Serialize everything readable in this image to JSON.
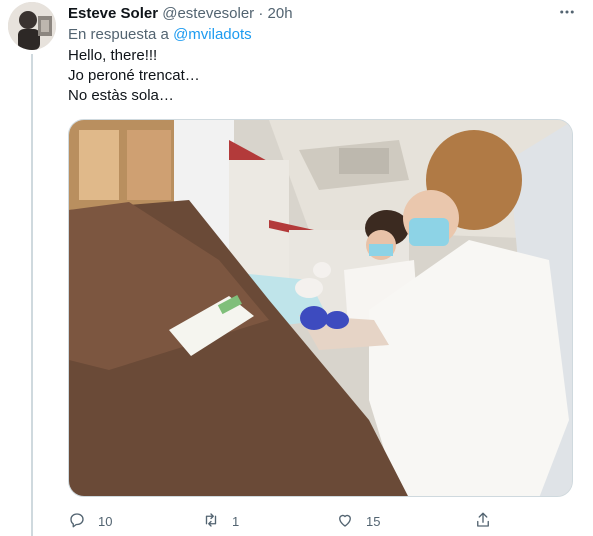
{
  "tweet": {
    "author_name": "Esteve Soler",
    "author_handle": "@estevesoler",
    "separator": "·",
    "time": "20h",
    "reply_prefix": "En respuesta a",
    "reply_to": "@mviladots",
    "text_lines": [
      "Hello, there!!!",
      "Jo peroné trencat…",
      "No estàs sola…"
    ]
  },
  "actions": {
    "reply_count": "10",
    "retweet_count": "1",
    "like_count": "15"
  },
  "icons": [
    "more-icon",
    "reply-icon",
    "retweet-icon",
    "like-icon",
    "share-icon"
  ],
  "colors": {
    "accent": "#1d9bf0",
    "secondary_text": "#536471",
    "border": "#cfd9de"
  }
}
